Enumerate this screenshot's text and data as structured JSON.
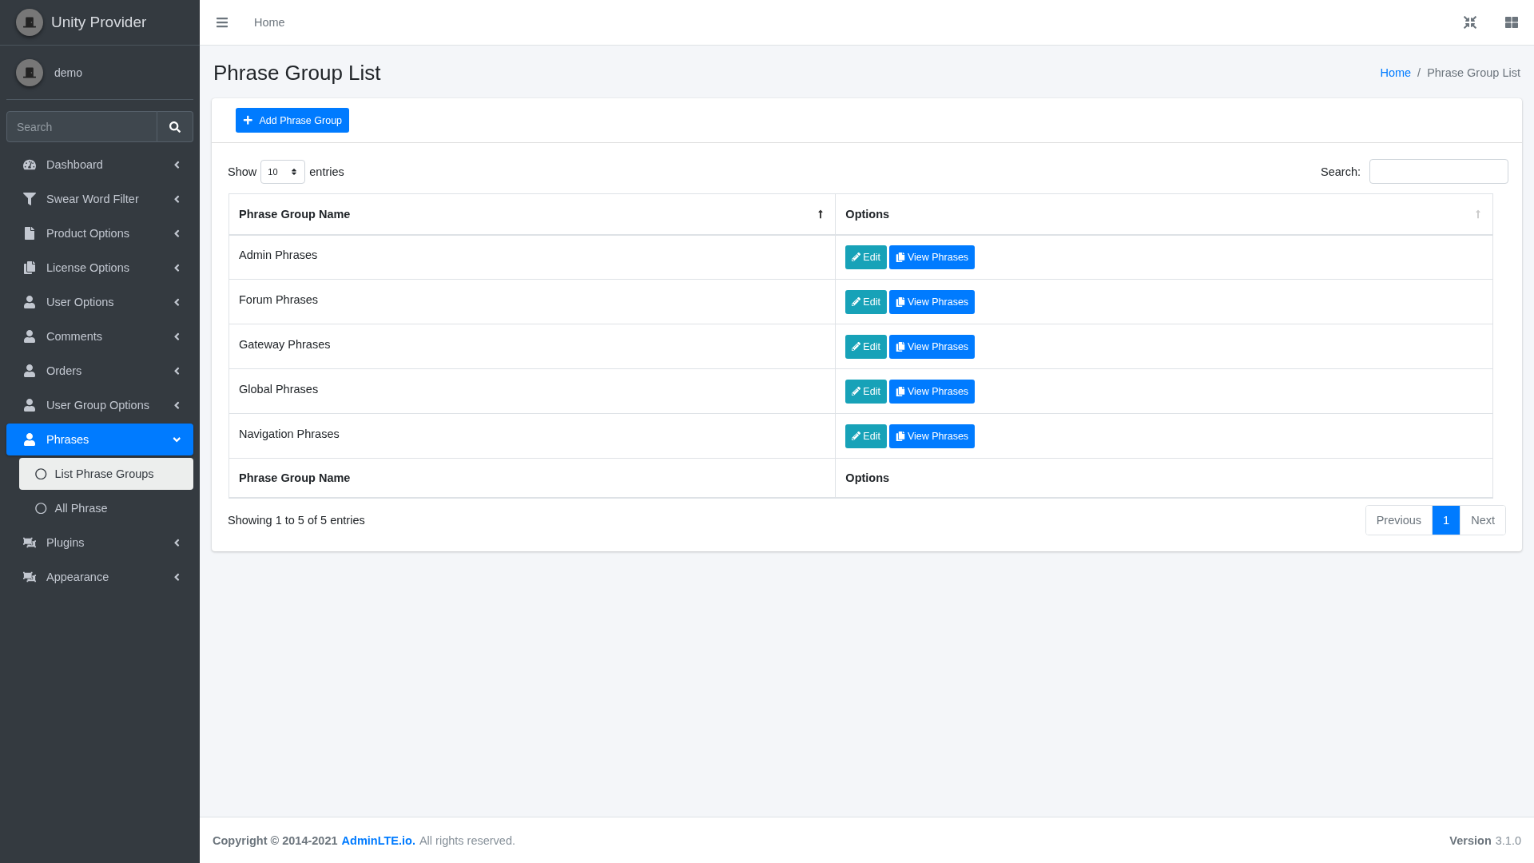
{
  "brand": {
    "title": "Unity Provider"
  },
  "user": {
    "name": "demo"
  },
  "sidebar_search": {
    "placeholder": "Search"
  },
  "sidebar": {
    "items": [
      {
        "label": "Dashboard",
        "selected": false,
        "expanded": false
      },
      {
        "label": "Swear Word Filter",
        "selected": false,
        "expanded": false
      },
      {
        "label": "Product Options",
        "selected": false,
        "expanded": false
      },
      {
        "label": "License Options",
        "selected": false,
        "expanded": false
      },
      {
        "label": "User Options",
        "selected": false,
        "expanded": false
      },
      {
        "label": "Comments",
        "selected": false,
        "expanded": false
      },
      {
        "label": "Orders",
        "selected": false,
        "expanded": false
      },
      {
        "label": "User Group Options",
        "selected": false,
        "expanded": false
      },
      {
        "label": "Phrases",
        "selected": true,
        "expanded": true,
        "children": [
          {
            "label": "List Phrase Groups",
            "selected": true
          },
          {
            "label": "All Phrase",
            "selected": false
          }
        ]
      },
      {
        "label": "Plugins",
        "selected": false,
        "expanded": false
      },
      {
        "label": "Appearance",
        "selected": false,
        "expanded": false
      }
    ]
  },
  "topbar": {
    "nav_link": "Home"
  },
  "page": {
    "title": "Phrase Group List",
    "separator": "/",
    "breadcrumb": [
      {
        "label": "Home",
        "selected": false
      },
      {
        "label": "Phrase Group List",
        "selected": true
      }
    ]
  },
  "card": {
    "add_button": "Add Phrase Group"
  },
  "table_controls": {
    "show_label": "Show",
    "page_size": "10",
    "entries_label": "entries",
    "search_label": "Search:"
  },
  "table": {
    "columns": [
      {
        "label": "Phrase Group Name",
        "sorted": true
      },
      {
        "label": "Options",
        "sorted": false
      }
    ],
    "rows": [
      {
        "name": "Admin Phrases",
        "actions": [
          {
            "kind": "edit",
            "label": "Edit"
          },
          {
            "kind": "view",
            "label": "View Phrases"
          }
        ]
      },
      {
        "name": "Forum Phrases",
        "actions": [
          {
            "kind": "edit",
            "label": "Edit"
          },
          {
            "kind": "view",
            "label": "View Phrases"
          }
        ]
      },
      {
        "name": "Gateway Phrases",
        "actions": [
          {
            "kind": "edit",
            "label": "Edit"
          },
          {
            "kind": "view",
            "label": "View Phrases"
          }
        ]
      },
      {
        "name": "Global Phrases",
        "actions": [
          {
            "kind": "edit",
            "label": "Edit"
          },
          {
            "kind": "view",
            "label": "View Phrases"
          }
        ]
      },
      {
        "name": "Navigation Phrases",
        "actions": [
          {
            "kind": "edit",
            "label": "Edit"
          },
          {
            "kind": "view",
            "label": "View Phrases"
          }
        ]
      }
    ],
    "footer": [
      "Phrase Group Name",
      "Options"
    ]
  },
  "table_info": "Showing 1 to 5 of 5 entries",
  "pagination": [
    {
      "label": "Previous",
      "selected": false,
      "disabled": true
    },
    {
      "label": "1",
      "selected": true,
      "disabled": false
    },
    {
      "label": "Next",
      "selected": false,
      "disabled": true
    }
  ],
  "footer": {
    "copyright": "Copyright © 2014-2021",
    "link": "AdminLTE.io.",
    "rights": "All rights reserved.",
    "version_label": "Version",
    "version": "3.1.0"
  }
}
